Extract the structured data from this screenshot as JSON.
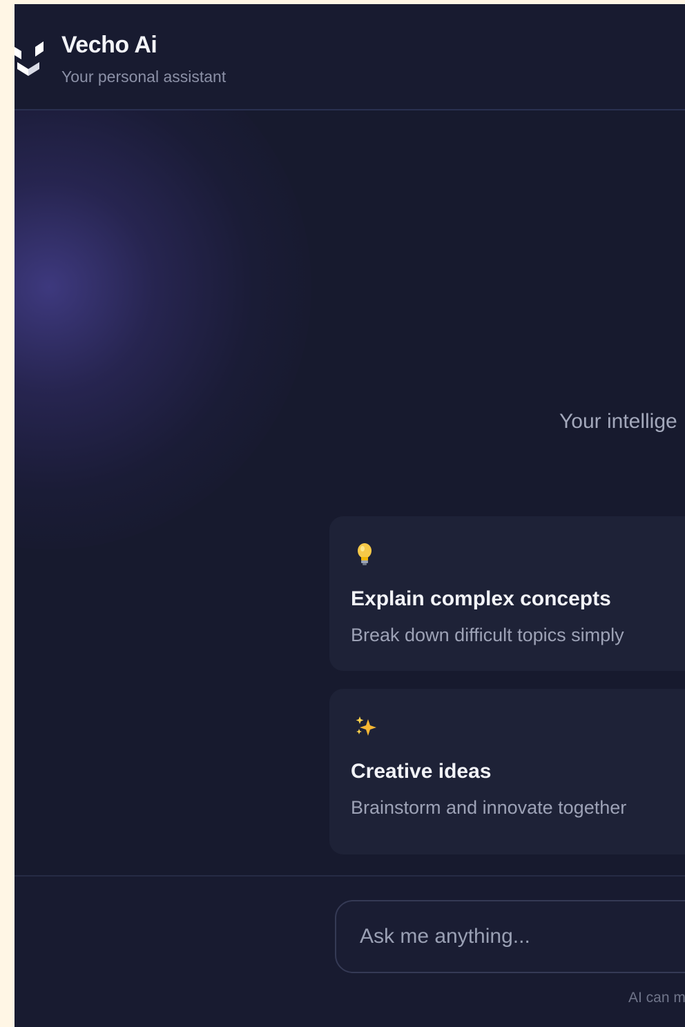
{
  "header": {
    "title": "Vecho Ai",
    "subtitle": "Your personal assistant",
    "logo_icon": "vecho-logo-icon"
  },
  "main": {
    "tagline": "Your intellige",
    "suggestions": [
      {
        "icon": "lightbulb-icon",
        "title": "Explain complex concepts",
        "description": "Break down difficult topics simply"
      },
      {
        "icon": "sparkles-icon",
        "title": "Creative ideas",
        "description": "Brainstorm and innovate together"
      }
    ]
  },
  "composer": {
    "placeholder": "Ask me anything...",
    "value": ""
  },
  "footer": {
    "disclaimer": "AI can m"
  },
  "colors": {
    "background": "#171a2e",
    "card": "#1e2237",
    "accent_glow": "#4e46a0",
    "text_primary": "#f3f4f8",
    "text_muted": "#9da2b6"
  }
}
